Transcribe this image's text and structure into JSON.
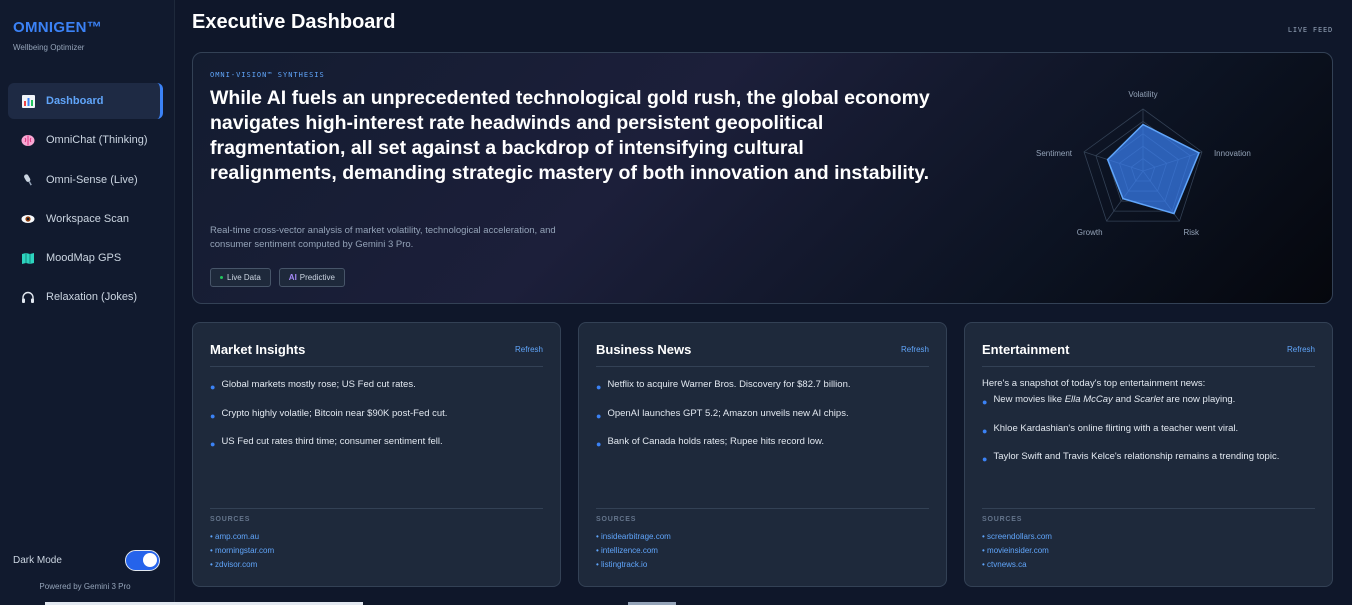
{
  "brand": {
    "title": "OMNIGEN™",
    "subtitle": "Wellbeing Optimizer"
  },
  "sidebar": {
    "items": [
      {
        "label": "Dashboard",
        "icon": "bar-chart-icon",
        "active": true
      },
      {
        "label": "OmniChat (Thinking)",
        "icon": "brain-icon"
      },
      {
        "label": "Omni-Sense (Live)",
        "icon": "microphone-icon"
      },
      {
        "label": "Workspace Scan",
        "icon": "eye-icon"
      },
      {
        "label": "MoodMap GPS",
        "icon": "map-icon"
      },
      {
        "label": "Relaxation (Jokes)",
        "icon": "headphones-icon"
      }
    ],
    "dark_mode_label": "Dark Mode",
    "dark_mode_on": true,
    "powered_by": "Powered by Gemini 3 Pro"
  },
  "header": {
    "title": "Executive Dashboard",
    "live_feed": "LIVE FEED"
  },
  "hero": {
    "tag": "OMNI-VISION™ SYNTHESIS",
    "headline": "While AI fuels an unprecedented technological gold rush, the global economy navigates high-interest rate headwinds and persistent geopolitical fragmentation, all set against a backdrop of intensifying cultural realignments, demanding strategic mastery of both innovation and instability.",
    "description": "Real-time cross-vector analysis of market volatility, technological acceleration, and consumer sentiment computed by Gemini 3 Pro.",
    "chip_live": "Live Data",
    "chip_ai_prefix": "AI",
    "chip_ai_text": "Predictive"
  },
  "radar": {
    "axes": [
      "Volatility",
      "Innovation",
      "Risk",
      "Growth",
      "Sentiment"
    ],
    "values": [
      0.75,
      0.95,
      0.85,
      0.55,
      0.6
    ],
    "fill_color": "#3b82f6"
  },
  "cards": [
    {
      "title": "Market Insights",
      "refresh": "Refresh",
      "items": [
        "Global markets mostly rose; US Fed cut rates.",
        "Crypto highly volatile; Bitcoin near $90K post-Fed cut.",
        "US Fed cut rates third time; consumer sentiment fell."
      ],
      "sources_label": "SOURCES",
      "sources": [
        "amp.com.au",
        "morningstar.com",
        "zdvisor.com"
      ]
    },
    {
      "title": "Business News",
      "refresh": "Refresh",
      "items": [
        "Netflix to acquire Warner Bros. Discovery for $82.7 billion.",
        "OpenAI launches GPT 5.2; Amazon unveils new AI chips.",
        "Bank of Canada holds rates; Rupee hits record low."
      ],
      "sources_label": "SOURCES",
      "sources": [
        "insidearbitrage.com",
        "intellizence.com",
        "listingtrack.io"
      ]
    },
    {
      "title": "Entertainment",
      "refresh": "Refresh",
      "intro": "Here's a snapshot of today's top entertainment news:",
      "item1_prefix": "New movies like ",
      "item1_em1": "Ella McCay",
      "item1_mid": " and ",
      "item1_em2": "Scarlet",
      "item1_suffix": " are now playing.",
      "items": [
        "Khloe Kardashian's online flirting with a teacher went viral.",
        "Taylor Swift and Travis Kelce's relationship remains a trending topic."
      ],
      "sources_label": "SOURCES",
      "sources": [
        "screendollars.com",
        "movieinsider.com",
        "ctvnews.ca"
      ]
    }
  ]
}
